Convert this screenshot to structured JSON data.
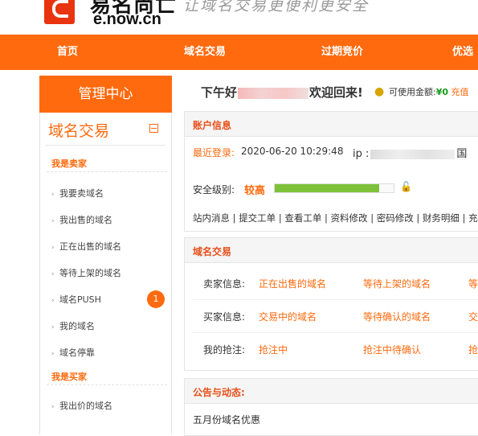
{
  "header": {
    "logo_cn": "易名尚亡",
    "logo_url": "e.now.cn",
    "slogan": "让域名交易更便利更安全"
  },
  "nav": {
    "items": [
      "首页",
      "域名交易",
      "过期竞价",
      "优选"
    ]
  },
  "sidebar": {
    "heading": "管理中心",
    "title": "域名交易",
    "seller_section": "我是卖家",
    "seller_items": [
      "我要卖域名",
      "我出售的域名",
      "正在出售的域名",
      "等待上架的域名",
      "域名PUSH",
      "我的域名",
      "域名停靠"
    ],
    "push_badge": "1",
    "buyer_section": "我是买家",
    "buyer_items": [
      "我出价的域名"
    ]
  },
  "greeting": {
    "prefix": "下午好",
    "suffix": "欢迎回来!",
    "balance_label": "可使用金额:",
    "balance_value": "¥0",
    "recharge": "充值"
  },
  "account": {
    "title": "账户信息",
    "last_login_label": "最近登录:",
    "last_login_time": "2020-06-20 10:29:48",
    "ip_label": "ip :",
    "ip_suffix": "国",
    "security_label": "安全级别:",
    "security_level": "较高",
    "security_progress": 0.88,
    "links": "站内消息 | 提交工单 | 查看工单 | 资料修改 | 密码修改 | 财务明细 | 充"
  },
  "trade": {
    "title": "域名交易",
    "rows": [
      {
        "label": "卖家信息:",
        "links": [
          "正在出售的域名",
          "等待上架的域名",
          "等"
        ]
      },
      {
        "label": "买家信息:",
        "links": [
          "交易中的域名",
          "等待确认的域名",
          "交"
        ]
      },
      {
        "label": "我的抢注:",
        "links": [
          "抢注中",
          "抢注中待确认",
          "抢"
        ]
      }
    ]
  },
  "notice": {
    "title": "公告与动态:",
    "first_item": "五月份域名优惠"
  },
  "colors": {
    "brand": "#ff6a0e",
    "logo_red": "#e8340f",
    "progress_green": "#7dc23a"
  }
}
